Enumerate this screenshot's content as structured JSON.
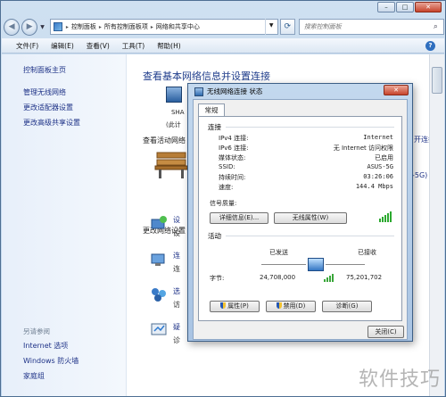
{
  "address": {
    "segments": [
      "控制面板",
      "所有控制面板项",
      "网络和共享中心"
    ],
    "search_placeholder": "搜索控制面板"
  },
  "menu": [
    "文件(F)",
    "编辑(E)",
    "查看(V)",
    "工具(T)",
    "帮助(H)"
  ],
  "sidebar": {
    "home": "控制面板主页",
    "links": [
      "管理无线网络",
      "更改适配器设置",
      "更改高级共享设置"
    ],
    "see_also_title": "另请参阅",
    "see_also": [
      "Internet 选项",
      "Windows 防火墙",
      "家庭组"
    ]
  },
  "main": {
    "title": "查看基本网络信息并设置连接",
    "computer_name": "SHA",
    "computer_sub": "(此计",
    "active_networks": "查看活动网络",
    "change_settings": "更改网络设置",
    "tasks": [
      {
        "t1": "设",
        "t2": "设"
      },
      {
        "t1": "连",
        "t2": "连"
      },
      {
        "t1": "选",
        "t2": "访"
      },
      {
        "t1": "疑",
        "t2": "诊"
      }
    ],
    "right_link": "开连接",
    "right_5g": "-5G)"
  },
  "dialog": {
    "title": "无线网络连接 状态",
    "tab": "常规",
    "connection_header": "连接",
    "rows": [
      {
        "label": "IPv4 连接:",
        "value": "Internet"
      },
      {
        "label": "IPv6 连接:",
        "value": "无 Internet 访问权限"
      },
      {
        "label": "媒体状态:",
        "value": "已启用"
      },
      {
        "label": "SSID:",
        "value": "ASUS-5G"
      },
      {
        "label": "持续时间:",
        "value": "03:26:06"
      },
      {
        "label": "速度:",
        "value": "144.4 Mbps"
      }
    ],
    "signal_label": "信号质量:",
    "details_button": "详细信息(E)...",
    "wireless_button": "无线属性(W)",
    "activity_header": "活动",
    "sent_label": "已发送",
    "received_label": "已接收",
    "bytes_label": "字节:",
    "bytes_sent": "24,708,000",
    "bytes_received": "75,201,702",
    "properties_button": "属性(P)",
    "disable_button": "禁用(D)",
    "diagnose_button": "诊断(G)",
    "close_button": "关闭(C)"
  },
  "watermark": "软件技巧"
}
